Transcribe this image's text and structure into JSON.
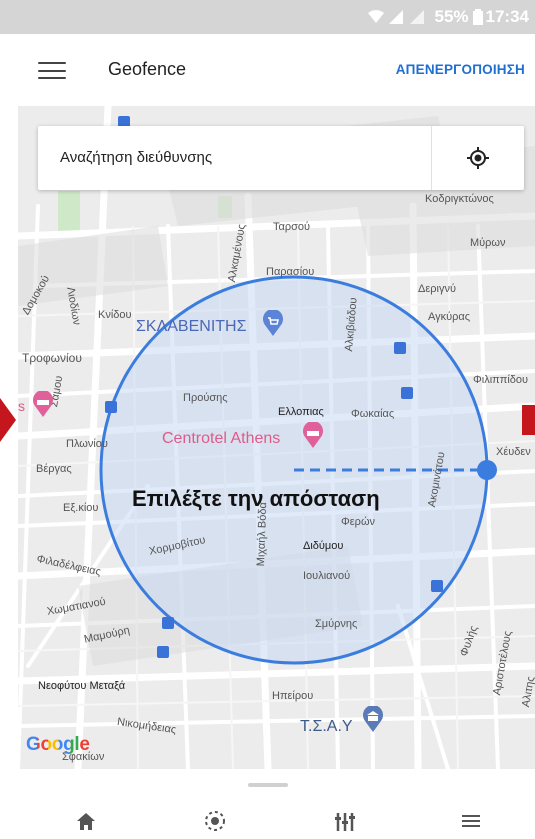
{
  "status_bar": {
    "battery": "55%",
    "time": "17:34"
  },
  "app_bar": {
    "title": "Geofence",
    "action": "ΑΠΕΝΕΡΓΟΠΟΙΗΣΗ"
  },
  "search": {
    "placeholder": "Αναζήτηση διεύθυνσης"
  },
  "map": {
    "distance_prompt": "Επιλέξτε την απόσταση",
    "attribution": "Google",
    "pois": {
      "supermarket": "ΣΚΛΑΒΕΝΙΤΗΣ",
      "hotel": "Centrotel Athens",
      "tsay": "Τ.Σ.Α.Υ",
      "ellopias": "Ελλοπιας"
    },
    "streets": [
      "Κοδριγκτώνος",
      "Ταρσού",
      "Μύρων",
      "Παρασίου",
      "Δεριγνύ",
      "Αγκύρας",
      "Κνίδου",
      "Αλκαμένους",
      "Αλκιβιάδου",
      "Δομοκού",
      "Λιοδίων",
      "Τροφωνίου",
      "Σάμου",
      "Φιλιππίδου",
      "Προύσης",
      "Φωκαίας",
      "Χέυδεν",
      "Πλωνίου",
      "Βέργας",
      "Εξ.κίου",
      "Φερών",
      "Χορμοβίτου",
      "Μιχαήλ Βόδα",
      "Διδύμου",
      "Ιουλιανού",
      "Φιλαδέλφειας",
      "Χωματιανού",
      "Μαμούρη",
      "Σμύρνης",
      "Φυλής",
      "Αριστοτέλους",
      "Αλιτης",
      "Νεοφύτου Μεταξά",
      "Ηπείρου",
      "Νικομήδειας",
      "Σφακίων",
      "Ακομινάτου"
    ]
  },
  "bottom_nav": [
    "home-icon",
    "geofence-icon",
    "controls-icon",
    "list-icon"
  ],
  "colors": {
    "accent": "#1f6fd1",
    "circle_stroke": "#3b7ddf",
    "circle_fill": "#cfdcf3",
    "brand_red": "#c4161c"
  }
}
